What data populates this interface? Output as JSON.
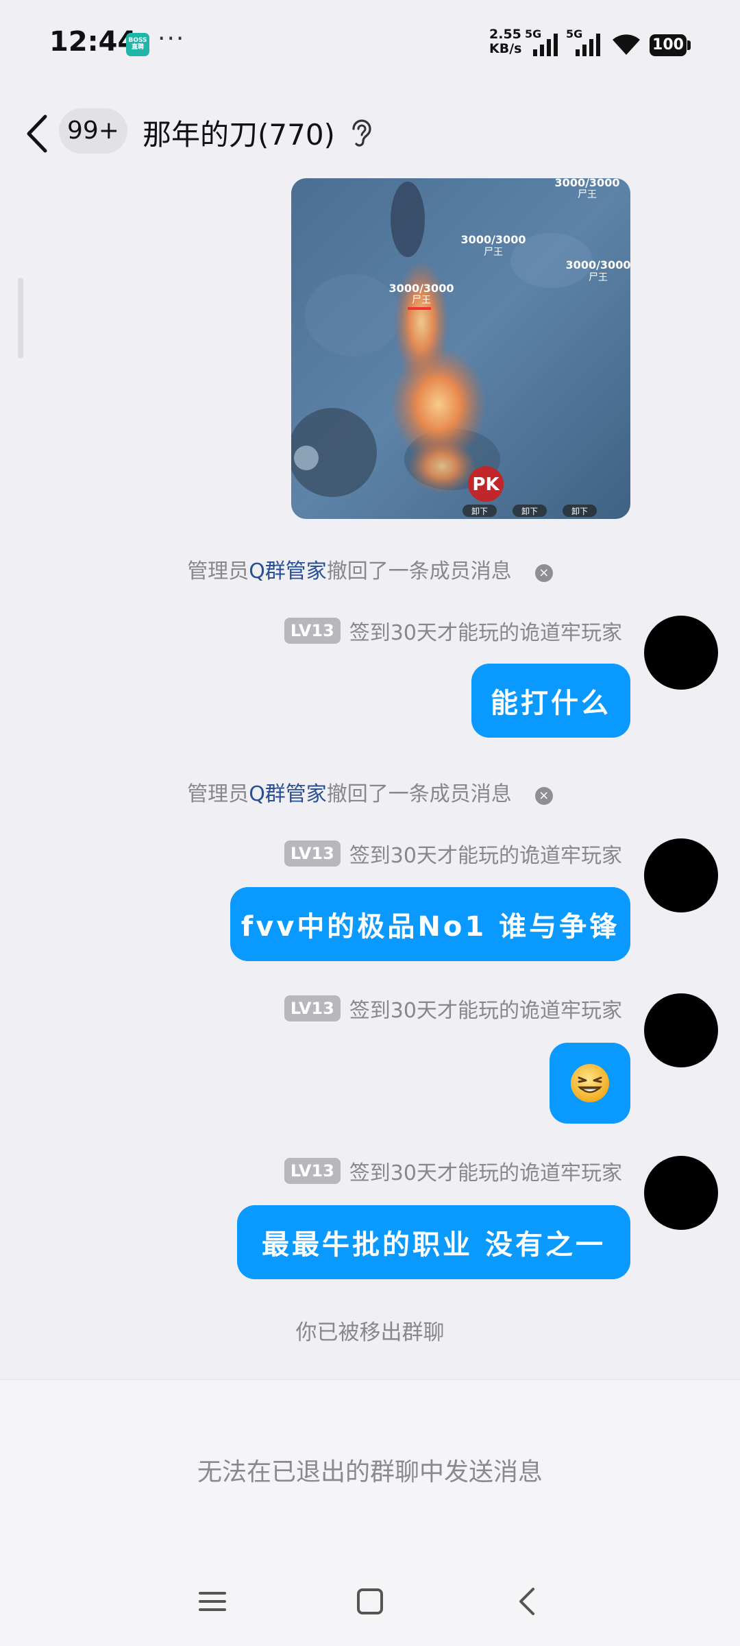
{
  "status_bar": {
    "time": "12:44",
    "app_badge": "BOSS直聘",
    "dots": "···",
    "net_speed_top": "2.55",
    "net_speed_bottom": "KB/s",
    "sig1_label": "5G",
    "sig2_label": "5G",
    "battery": "100"
  },
  "header": {
    "unread_count": "99+",
    "title": "那年的刀(770)"
  },
  "messages": {
    "recall_1": {
      "prefix": "管理员",
      "admin": "Q群管家",
      "suffix": "撤回了一条成员消息"
    },
    "recall_2": {
      "prefix": "管理员",
      "admin": "Q群管家",
      "suffix": "撤回了一条成员消息"
    },
    "msg1": {
      "level": "LV13",
      "sender": "签到30天才能玩的诡道牢玩家",
      "text": "能打什么"
    },
    "msg2": {
      "level": "LV13",
      "sender": "签到30天才能玩的诡道牢玩家",
      "text": "fvv中的极品No1 谁与争锋"
    },
    "msg3": {
      "level": "LV13",
      "sender": "签到30天才能玩的诡道牢玩家",
      "emoji": "grinning-squint-emoji"
    },
    "msg4": {
      "level": "LV13",
      "sender": "签到30天才能玩的诡道牢玩家",
      "text": "最最牛批的职业 没有之一"
    },
    "removed_notice": "你已被移出群聊"
  },
  "game_image": {
    "hp_labels": [
      "3000/3000",
      "3000/3000",
      "3000/3000",
      "3000/3000"
    ],
    "name_labels": [
      "尸王",
      "尸王",
      "尸王",
      "尸王"
    ],
    "pk_button": "PK",
    "small_buttons": [
      "卸下",
      "卸下",
      "卸下"
    ]
  },
  "input": {
    "disabled_text": "无法在已退出的群聊中发送消息"
  },
  "colors": {
    "bubble": "#0a99ff",
    "admin_link": "#2a4f95",
    "background": "#efeff4"
  }
}
